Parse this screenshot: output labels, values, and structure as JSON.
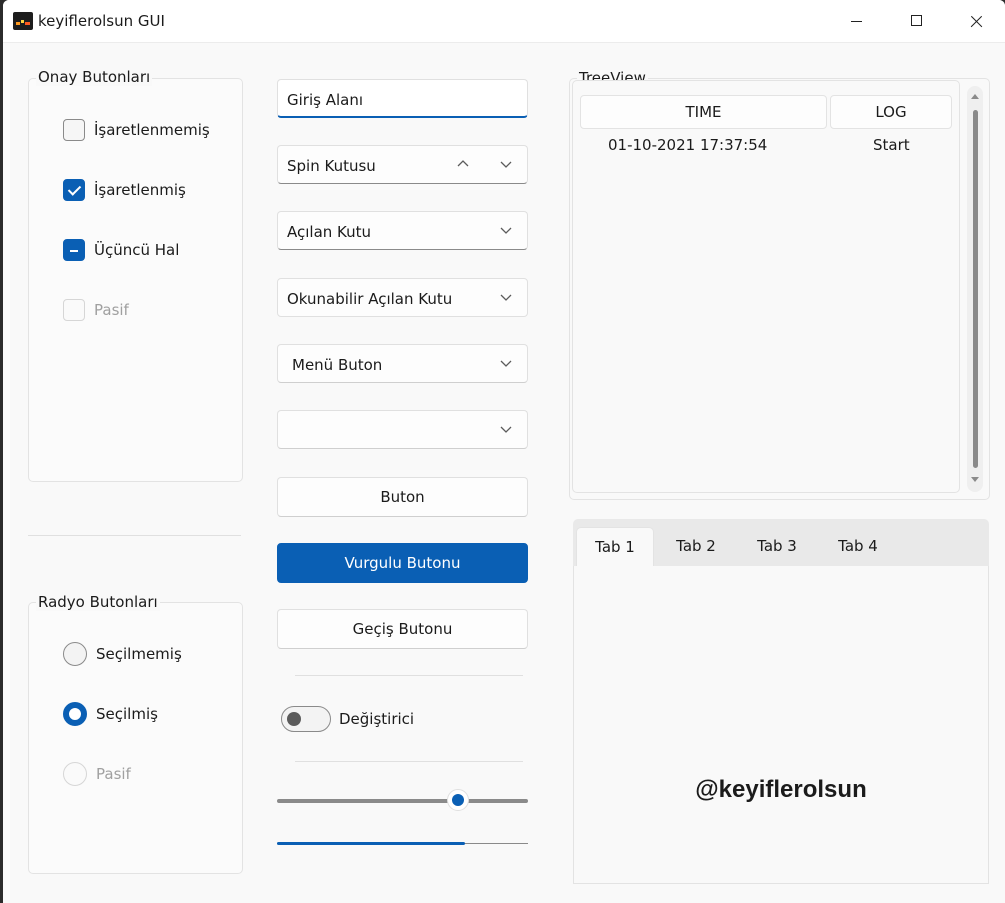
{
  "window": {
    "title": "keyiflerolsun GUI",
    "controls": [
      "minimize-icon",
      "maximize-icon",
      "close-icon"
    ]
  },
  "checkbuttons": {
    "group_label": "Onay Butonları",
    "items": [
      {
        "label": "İşaretlenmemiş",
        "state": "unchecked"
      },
      {
        "label": "İşaretlenmiş",
        "state": "checked"
      },
      {
        "label": "Üçüncü Hal",
        "state": "indeterminate"
      },
      {
        "label": "Pasif",
        "state": "disabled"
      }
    ]
  },
  "radiobuttons": {
    "group_label": "Radyo Butonları",
    "items": [
      {
        "label": "Seçilmemiş",
        "state": "unselected"
      },
      {
        "label": "Seçilmiş",
        "state": "selected"
      },
      {
        "label": "Pasif",
        "state": "disabled"
      }
    ]
  },
  "widgets": {
    "entry_value": "Giriş Alanı",
    "spinbox_value": "Spin Kutusu",
    "combobox_value": "Açılan Kutu",
    "readonly_combobox_value": "Okunabilir Açılan Kutu",
    "menubutton_label": "Menü Buton",
    "optionmenu_value": "",
    "button_label": "Buton",
    "accent_button_label": "Vurgulu Butonu",
    "toggle_button_label": "Geçiş Butonu",
    "switch_label": "Değiştirici",
    "switch_on": false,
    "slider_value_fraction": 0.72,
    "progress_fraction": 0.75
  },
  "treeview": {
    "group_label": "TreeView",
    "columns": [
      "TIME",
      "LOG"
    ],
    "rows": [
      {
        "time": "01-10-2021 17:37:54",
        "log": "Start"
      }
    ]
  },
  "notebook": {
    "tabs": [
      "Tab 1",
      "Tab 2",
      "Tab 3",
      "Tab 4"
    ],
    "active_tab": 0,
    "content_text": "@keyiflerolsun"
  },
  "colors": {
    "accent": "#0a5fb4",
    "window_bg": "#f9f9f9"
  }
}
